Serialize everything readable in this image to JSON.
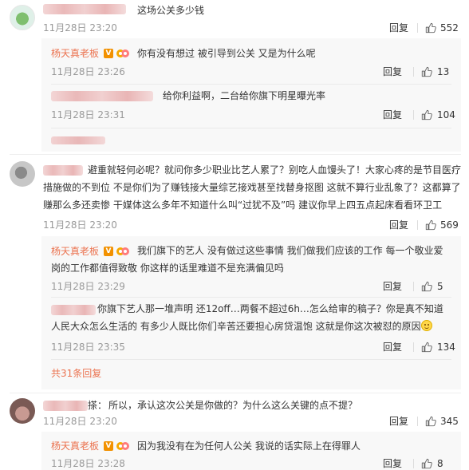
{
  "comments": [
    {
      "text": "这场公关多少钱",
      "time": "11月28日 23:20",
      "reply_label": "回复",
      "likes": "552",
      "replies": [
        {
          "author": "杨天真老板",
          "text": "你有没有想过 被引导到公关 又是为什么呢",
          "time": "11月28日 23:26",
          "reply_label": "回复",
          "likes": "13"
        },
        {
          "text": "给你利益啊，二台给你旗下明星曝光率",
          "time": "11月28日 23:31",
          "reply_label": "回复",
          "likes": "104"
        }
      ]
    },
    {
      "text": "避重就轻何必呢？就问你多少职业比艺人累了？别吃人血馒头了！大家心疼的是节目医疗措施做的不到位 不是你们为了赚钱接大量综艺接戏甚至找替身抠图 这就不算行业乱象了？这都算了赚那么多还卖惨 干媒体这么多年不知道什么叫“过犹不及”吗 建议你早上四五点起床看看环卫工",
      "time": "11月28日 23:20",
      "reply_label": "回复",
      "likes": "569",
      "replies": [
        {
          "author": "杨天真老板",
          "text": "我们旗下的艺人 没有做过这些事情 我们做我们应该的工作 每一个敬业爱岗的工作都值得致敬 你这样的话里难道不是充满偏见吗",
          "time": "11月28日 23:29",
          "reply_label": "回复",
          "likes": "5"
        },
        {
          "text": "你旗下艺人那一堆声明 还12off…两餐不超过6h…怎么给审的稿子？你是真不知道人民大众怎么生活的 有多少人既比你们辛苦还要担心房贷温饱 这就是你这次被怼的原因",
          "time": "11月28日 23:35",
          "reply_label": "回复",
          "likes": "134"
        }
      ],
      "more_replies": "共31条回复"
    },
    {
      "name_suffix": "搽：",
      "text": "所以，承认这次公关是你做的？为什么这么关键的点不提？",
      "time": "11月28日 23:20",
      "reply_label": "回复",
      "likes": "345",
      "replies": [
        {
          "author": "杨天真老板",
          "text": "因为我没有在为任何人公关 我说的话实际上在得罪人",
          "time": "11月28日 23:28",
          "reply_label": "回复",
          "likes": "8"
        }
      ]
    }
  ],
  "icons": {
    "like": "thumbs-up-icon",
    "verified": "verified-v-icon",
    "fan": "fan-badge-icon",
    "emoji": "smile-emoji-icon"
  },
  "colors": {
    "author": "#eb7350",
    "verified": "#f29100",
    "muted": "#999999",
    "subbox_bg": "#f8f8f8"
  },
  "verified_glyph": "V"
}
